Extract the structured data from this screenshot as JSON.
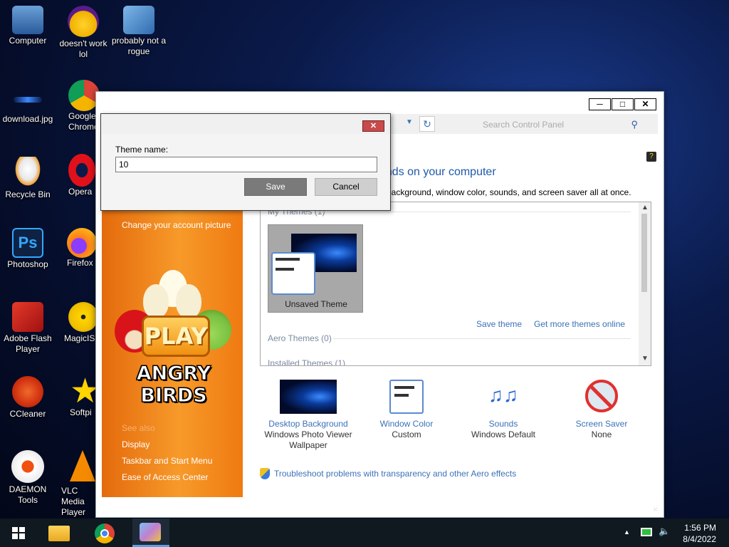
{
  "desktop": {
    "icons": [
      {
        "label": "Computer"
      },
      {
        "label": "doesn't work lol"
      },
      {
        "label": "probably not a rogue"
      },
      {
        "label": "download.jpg"
      },
      {
        "label": "Google Chrome"
      },
      {
        "label": "Recycle Bin"
      },
      {
        "label": "Opera"
      },
      {
        "label": "Photoshop"
      },
      {
        "label": "Firefox"
      },
      {
        "label": "Adobe Flash Player"
      },
      {
        "label": "MagicIS"
      },
      {
        "label": "CCleaner"
      },
      {
        "label": "Softpi"
      },
      {
        "label": "DAEMON Tools"
      },
      {
        "label": "VLC Media Player"
      }
    ]
  },
  "window": {
    "search_placeholder": "Search Control Panel",
    "heading": "unds on your computer",
    "subheading": "p background, window color, sounds, and screen saver all at once.",
    "sidebar": {
      "change_picture": "Change your account picture",
      "see_also": "See also",
      "links": [
        "Display",
        "Taskbar and Start Menu",
        "Ease of Access Center"
      ],
      "ad_text_play": "PLAY",
      "ad_text_title": "ANGRY BIRDS"
    },
    "themes": {
      "my_themes": "My Themes (1)",
      "unsaved_theme": "Unsaved Theme",
      "save_theme": "Save theme",
      "get_more": "Get more themes online",
      "aero_themes": "Aero Themes (0)",
      "installed_themes": "Installed Themes (1)"
    },
    "bottom": [
      {
        "title": "Desktop Background",
        "sub": "Windows Photo Viewer Wallpaper",
        "icon": "desktop-background-icon"
      },
      {
        "title": "Window Color",
        "sub": "Custom",
        "icon": "window-color-icon"
      },
      {
        "title": "Sounds",
        "sub": "Windows Default",
        "icon": "sounds-icon"
      },
      {
        "title": "Screen Saver",
        "sub": "None",
        "icon": "screen-saver-icon"
      }
    ],
    "troubleshoot": "Troubleshoot problems with transparency and other Aero effects"
  },
  "dialog": {
    "label": "Theme name:",
    "value": "10",
    "save": "Save",
    "cancel": "Cancel"
  },
  "taskbar": {
    "time": "1:56 PM",
    "date": "8/4/2022"
  },
  "colors": {
    "accent_link": "#3b72b8",
    "sidebar_orange": "#f08418",
    "dialog_close": "#c94a4a"
  }
}
